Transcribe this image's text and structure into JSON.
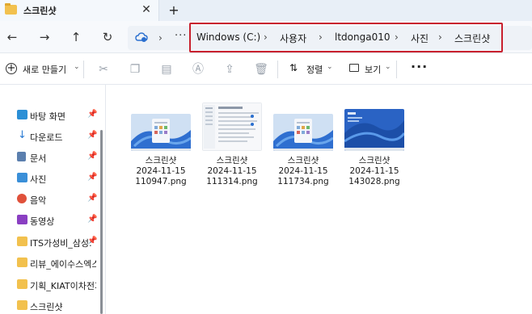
{
  "window": {
    "tab_title": "스크린샷",
    "tab_close": "✕",
    "new_tab": "+"
  },
  "nav": {
    "back": "←",
    "forward": "→",
    "up": "↑",
    "refresh": "↻"
  },
  "address": {
    "overflow": "···",
    "breadcrumbs": [
      "Windows (C:)",
      "사용자",
      "ltdonga010",
      "사진",
      "스크린샷"
    ],
    "separator": "›"
  },
  "toolbar": {
    "new_label": "새로 만들기",
    "sort_label": "정렬",
    "view_label": "보기",
    "more": "···"
  },
  "sidebar": {
    "items": [
      {
        "label": "바탕 화면",
        "icon": "desktop-icon",
        "pinned": true,
        "color": "#2b8fd6"
      },
      {
        "label": "다운로드",
        "icon": "download-icon",
        "pinned": true,
        "color": "#2a7bd3"
      },
      {
        "label": "문서",
        "icon": "document-icon",
        "pinned": true,
        "color": "#5b7fae"
      },
      {
        "label": "사진",
        "icon": "pictures-icon",
        "pinned": true,
        "color": "#3a8fd8"
      },
      {
        "label": "음악",
        "icon": "music-icon",
        "pinned": true,
        "color": "#e0513b"
      },
      {
        "label": "동영상",
        "icon": "video-icon",
        "pinned": true,
        "color": "#8a3fc2"
      },
      {
        "label": "ITS가성비_삼성:",
        "icon": "folder-icon",
        "pinned": true,
        "color": "#f2c14e"
      },
      {
        "label": "리뷰_에이수스엑스",
        "icon": "folder-icon",
        "pinned": false,
        "color": "#f2c14e"
      },
      {
        "label": "기획_KIAT이차전지",
        "icon": "folder-icon",
        "pinned": false,
        "color": "#f2c14e"
      },
      {
        "label": "스크린샷",
        "icon": "folder-icon",
        "pinned": false,
        "color": "#f2c14e"
      }
    ]
  },
  "files": [
    {
      "name": "스크린샷",
      "date": "2024-11-15",
      "suffix": "110947.png",
      "thumb": "win11-desktop-start"
    },
    {
      "name": "스크린샷",
      "date": "2024-11-15",
      "suffix": "111314.png",
      "thumb": "settings-window"
    },
    {
      "name": "스크린샷",
      "date": "2024-11-15",
      "suffix": "111734.png",
      "thumb": "win11-desktop-start"
    },
    {
      "name": "스크린샷",
      "date": "2024-11-15",
      "suffix": "143028.png",
      "thumb": "win11-desktop"
    }
  ],
  "colors": {
    "accent_highlight": "#c8202e",
    "folder": "#f2c14e",
    "win11_wallpaper": "#2f6fd0"
  }
}
